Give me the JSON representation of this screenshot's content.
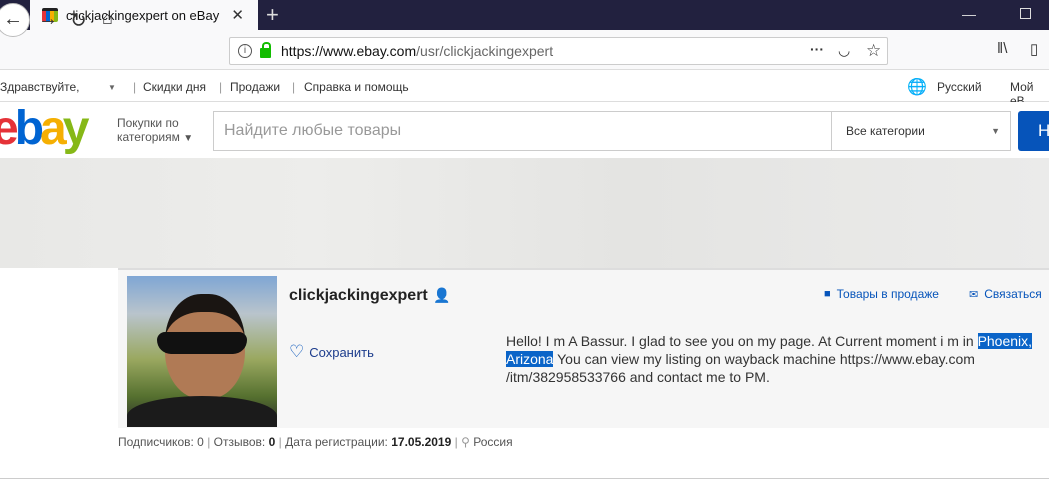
{
  "browser": {
    "tab_title": "clickjackingexpert on eBay",
    "url_domain": "https://www.ebay.com",
    "url_path": "/usr/clickjackingexpert"
  },
  "toplinks": {
    "greeting": "Здравствуйте,",
    "deals": "Скидки дня",
    "selling": "Продажи",
    "help": "Справка и помощь",
    "language": "Русский",
    "my_ebay": "Мой eB"
  },
  "header": {
    "logo": "ebay",
    "shop_by_category": [
      "Покупки по",
      "категориям"
    ],
    "search_placeholder": "Найдите любые товары",
    "category_select": "Все категории",
    "search_button": "Н"
  },
  "profile": {
    "username": "clickjackingexpert",
    "save_label": "Сохранить",
    "items_for_sale": "Товары в продаже",
    "contact": "Связаться",
    "description": {
      "line1": "Hello! I m A Bassur. I glad to see you on my page. At Current moment i m in ",
      "hl1": "Phoenix,",
      "hl2": "Arizona",
      "line2": " You can view my listing on wayback machine https://www.ebay.com",
      "line3": "/itm/382958533766 and contact me to PM."
    },
    "stats": {
      "followers_label": "Подписчиков: ",
      "followers": "0",
      "reviews_label": "Отзывов: ",
      "reviews": "0",
      "registered_label": "Дата регистрации: ",
      "registered": "17.05.2019",
      "location": "Россия"
    }
  },
  "colors": {
    "ebay_blue": "#0654ba",
    "highlight": "#0a64c8",
    "tabbar": "#22213f"
  }
}
